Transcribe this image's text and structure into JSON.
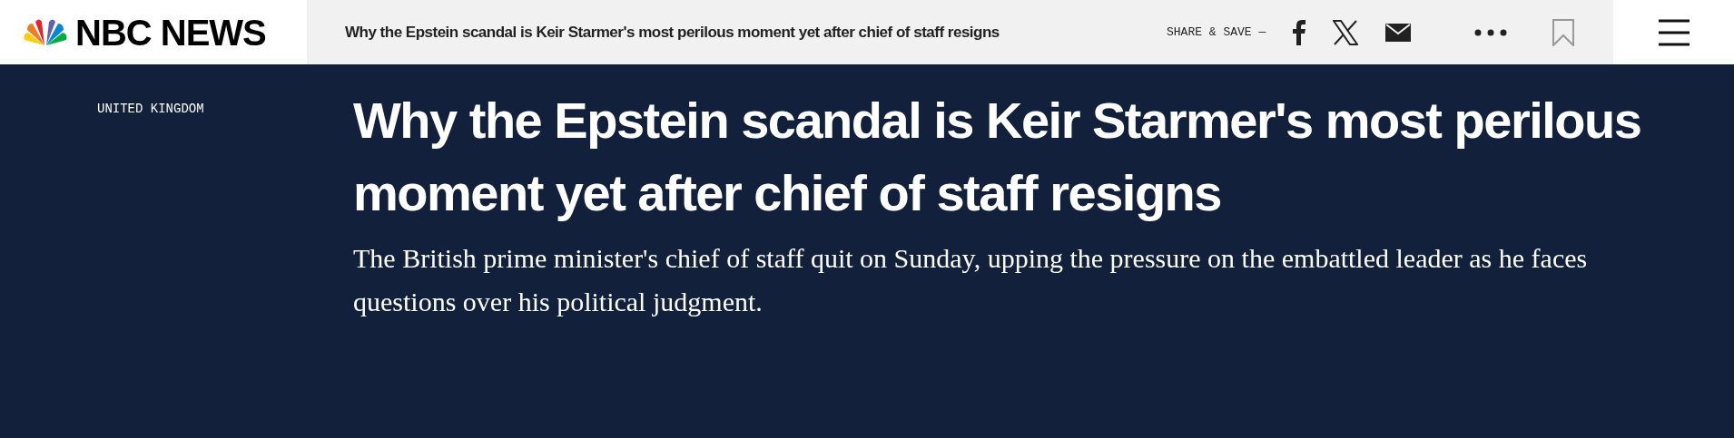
{
  "header": {
    "logo_text": "NBC NEWS",
    "article_title": "Why the Epstein scandal is Keir Starmer's most perilous moment yet after chief of staff resigns",
    "share_label": "SHARE & SAVE —",
    "share_icons": [
      {
        "kind": "facebook"
      },
      {
        "kind": "x"
      },
      {
        "kind": "email"
      },
      {
        "kind": "more"
      },
      {
        "kind": "bookmark"
      }
    ]
  },
  "article": {
    "section": "UNITED KINGDOM",
    "headline": "Why the Epstein scandal is Keir Starmer's most perilous moment yet after chief of staff resigns",
    "dek": "The British prime minister's chief of staff quit on Sunday, upping the pressure on the embattled leader as he faces questions over his political judgment."
  }
}
